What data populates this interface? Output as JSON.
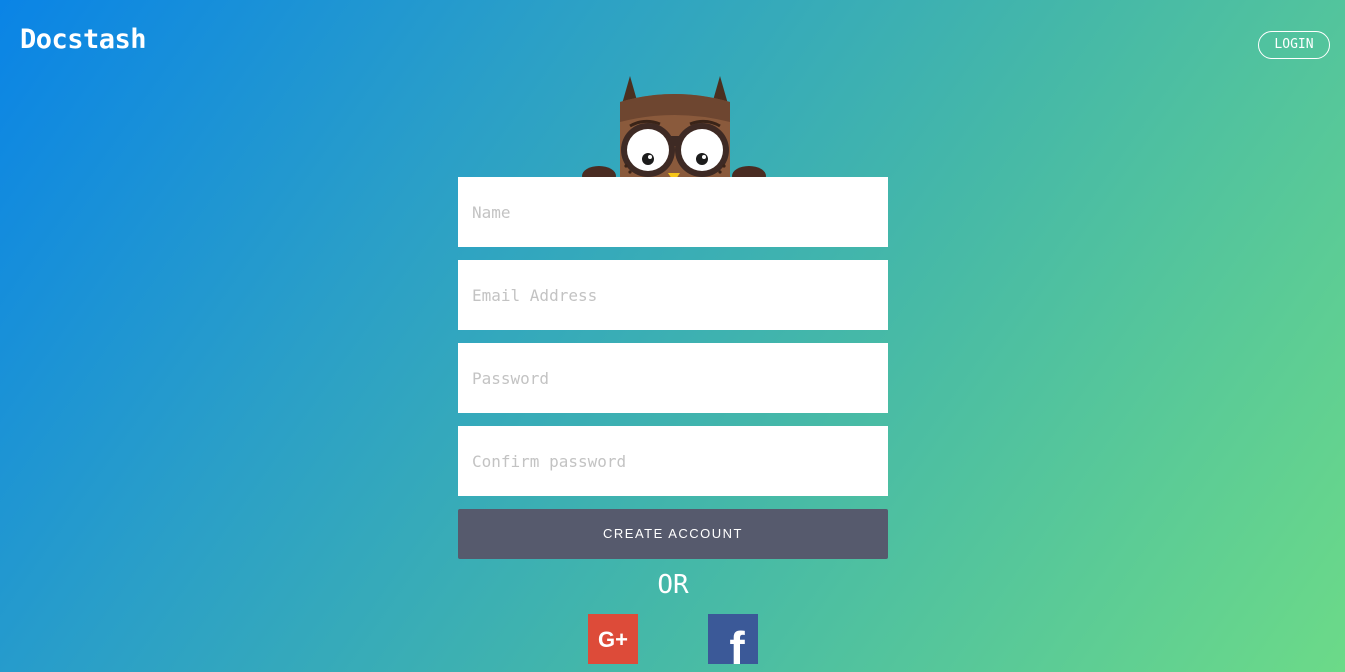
{
  "header": {
    "brand": "Docstash",
    "login_label": "LOGIN"
  },
  "mascot": {
    "icon": "owl-icon"
  },
  "form": {
    "name_placeholder": "Name",
    "email_placeholder": "Email Address",
    "password_placeholder": "Password",
    "confirm_placeholder": "Confirm password",
    "submit_label": "CREATE ACCOUNT",
    "or_text": "OR"
  },
  "social": {
    "google_label": "G+",
    "google_icon": "google-plus-icon",
    "facebook_label": "f",
    "facebook_icon": "facebook-icon"
  },
  "colors": {
    "gradient_start": "#0a84e6",
    "gradient_end": "#6cda88",
    "button": "#565a6d",
    "google": "#dd4b39",
    "facebook": "#3b5998"
  }
}
